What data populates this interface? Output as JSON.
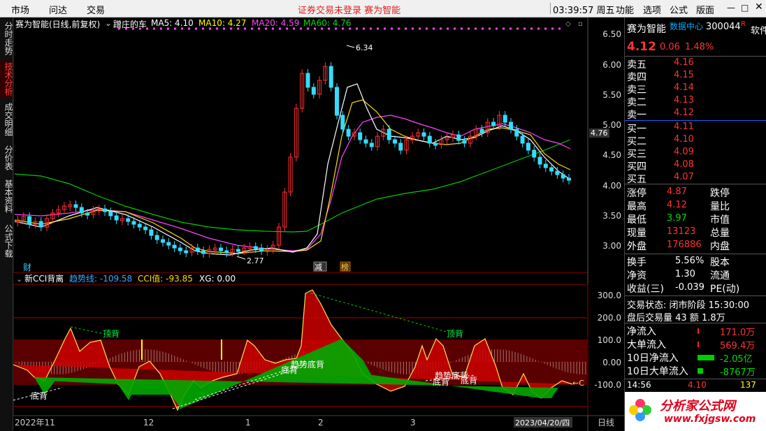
{
  "menubar": {
    "items": [
      "市场",
      "问达",
      "交易"
    ],
    "notice": "证券交易未登录 赛为智能",
    "clock": "03:39:57 周五",
    "right_menu": [
      "功能",
      "选项",
      "公式",
      "版面"
    ]
  },
  "left_tabs": [
    "分时走势",
    "技术分析",
    "成交明细",
    "分价表",
    "基本资料",
    "公式下载"
  ],
  "main_header": {
    "title": "赛为智能(日线,前复权)",
    "indicator": "蹭庄的车",
    "ma5": "MA5: 4.10",
    "ma10": "MA10: 4.27",
    "ma20": "MA20: 4.59",
    "ma60": "MA60: 4.76"
  },
  "price_axis": [
    "6.50",
    "6.00",
    "5.50",
    "5.00",
    "4.50",
    "4.00",
    "3.50",
    "3.00"
  ],
  "price_marker": "4.76",
  "annotations": {
    "high": "6.34",
    "low": "2.77",
    "cai": "财",
    "tag1": "减",
    "tag2": "榜"
  },
  "cci_header": {
    "title": "新CCI背离",
    "trend": "趋势线: -109.58",
    "cci": "CCI值: -93.85",
    "xg": "XG: 0.00"
  },
  "cci_axis": [
    "300.0",
    "200.0",
    "100.0",
    "0.00",
    "-100.0"
  ],
  "cci_labels": {
    "dibei1": "底背",
    "dingbei1": "顶背",
    "dibei2": "底背",
    "qushi1": "趋势底背",
    "dingbei2": "顶背",
    "qushi2": "趋势底背",
    "dibei3": "底背",
    "dibei4": "底背"
  },
  "date_axis": [
    "2022年11",
    "12",
    "1",
    "2",
    "3",
    "2023/04/20/四"
  ],
  "period": "日线",
  "quote": {
    "name": "赛为智能",
    "data_center": "数据中心",
    "code": "300044",
    "r": "R",
    "soft": "软件",
    "price": "4.12",
    "change": "0.06",
    "pct": "1.48%",
    "asks": [
      [
        "卖五",
        "4.16"
      ],
      [
        "卖四",
        "4.15"
      ],
      [
        "卖三",
        "4.14"
      ],
      [
        "卖二",
        "4.13"
      ],
      [
        "卖一",
        "4.12"
      ]
    ],
    "bids": [
      [
        "买一",
        "4.11"
      ],
      [
        "买二",
        "4.10"
      ],
      [
        "买三",
        "4.09"
      ],
      [
        "买四",
        "4.08"
      ],
      [
        "买五",
        "4.07"
      ]
    ],
    "stats": [
      [
        "涨停",
        "4.87",
        "跌停"
      ],
      [
        "最高",
        "4.12",
        "量比"
      ],
      [
        "最低",
        "3.97",
        "市值"
      ],
      [
        "现量",
        "13123",
        "总量"
      ],
      [
        "外盘",
        "176886",
        "内盘"
      ]
    ],
    "stats2": [
      [
        "换手",
        "5.56%",
        "股本"
      ],
      [
        "净资",
        "1.30",
        "流通"
      ],
      [
        "收益(三)",
        "-0.039",
        "PE(动)"
      ]
    ],
    "status": "交易状态: 闭市阶段 15:30:00",
    "after": "盘后交易量 43 额 1.8万",
    "flows": [
      [
        "净流入",
        "171.0万"
      ],
      [
        "大单流入",
        "569.4万"
      ],
      [
        "10日净流入",
        "-2.05亿"
      ],
      [
        "10日大单流入",
        "-8767万"
      ]
    ],
    "tick": [
      "14:56",
      "4.10",
      "137"
    ]
  },
  "watermark": {
    "text": "分析家公式网",
    "url": "www.fxjgsw.com"
  }
}
